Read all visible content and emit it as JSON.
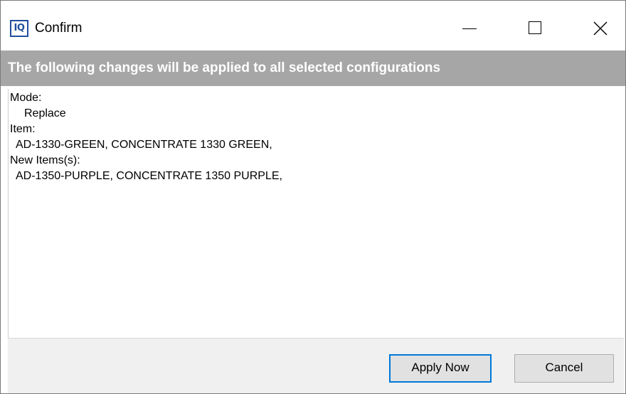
{
  "window": {
    "title": "Confirm",
    "app_icon_text": "IQ"
  },
  "header": {
    "text": "The following changes will be applied to all selected configurations"
  },
  "details": {
    "mode_label": "Mode:",
    "mode_value": "Replace",
    "item_label": "Item:",
    "item_value": "AD-1330-GREEN, CONCENTRATE 1330 GREEN,",
    "new_items_label": "New Items(s):",
    "new_items_value": "AD-1350-PURPLE, CONCENTRATE 1350 PURPLE,"
  },
  "buttons": {
    "apply_label": "Apply Now",
    "cancel_label": "Cancel"
  },
  "icons": {
    "minimize": "minimize-icon",
    "maximize": "maximize-icon",
    "close": "close-icon"
  },
  "colors": {
    "header_band": "#a6a6a6",
    "header_text": "#ffffff",
    "default_button_border": "#0078d7",
    "app_icon": "#1f4e9c"
  }
}
